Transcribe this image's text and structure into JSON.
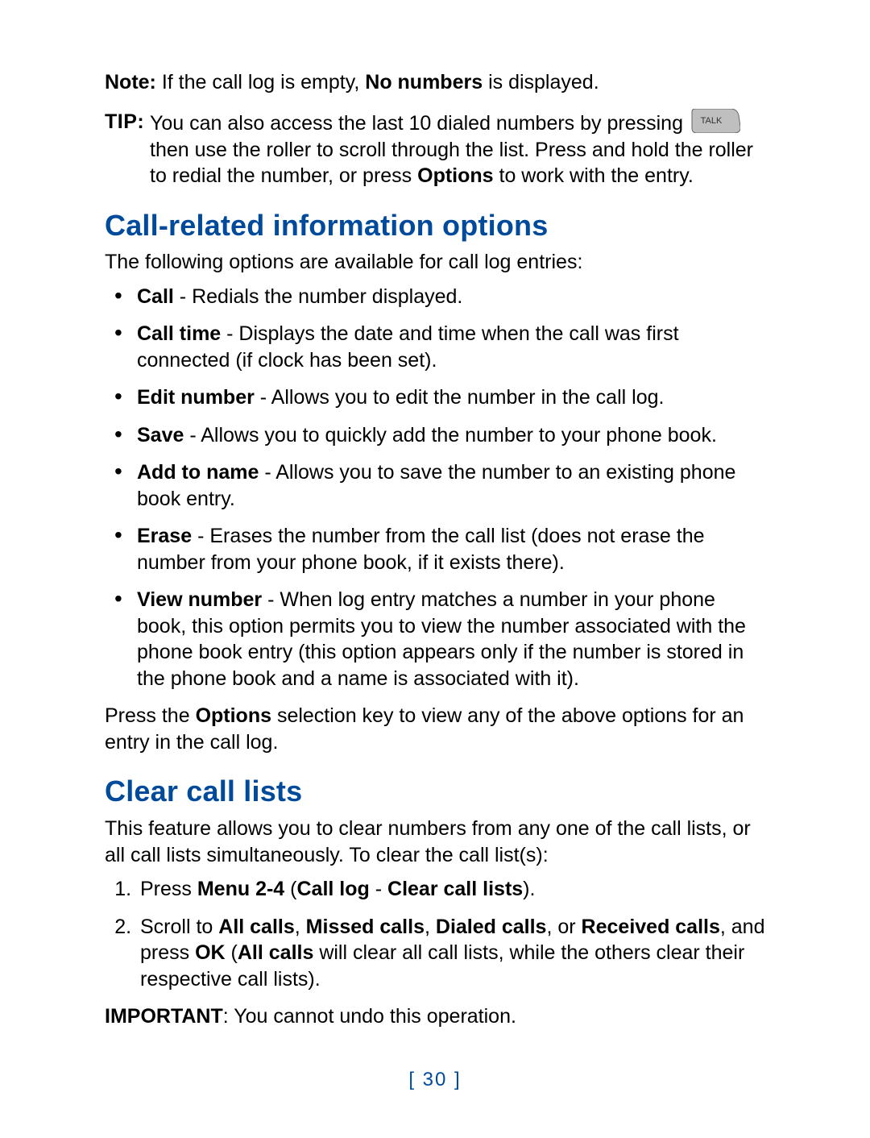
{
  "note": {
    "label": "Note:",
    "pre": "  If the call log is empty, ",
    "bold": "No numbers",
    "post": " is displayed."
  },
  "tip": {
    "label": "TIP:",
    "line1": "You can also access the last 10 dialed numbers by pressing ",
    "rest_pre": "then use the roller to scroll through the list. Press and hold the roller to redial the number, or press ",
    "options_word": "Options",
    "rest_post": " to work with the entry."
  },
  "section1": {
    "heading": "Call-related information options",
    "intro": "The following options are available for call log entries:",
    "bullets": [
      {
        "term": "Call",
        "desc": " - Redials the number displayed."
      },
      {
        "term": "Call time",
        "desc": " - Displays the date and time when the call was first connected (if clock has been set)."
      },
      {
        "term": "Edit number",
        "desc": " - Allows you to edit the number in the call log."
      },
      {
        "term": "Save",
        "desc": " - Allows you to quickly add the number to your phone book."
      },
      {
        "term": "Add to name",
        "desc": " - Allows you to save the number to an existing phone book entry."
      },
      {
        "term": "Erase",
        "desc": " - Erases the number from the call list (does not erase the number from your phone book, if it exists there)."
      },
      {
        "term": "View number",
        "desc": " - When log entry matches a number in your phone book, this option permits you to view the number associated with the phone book entry (this option appears only if the number is stored in the phone book and a name is associated with it)."
      }
    ],
    "outro_pre": "Press the ",
    "outro_bold": "Options",
    "outro_post": " selection key to view any of the above options for an entry in the call log."
  },
  "section2": {
    "heading": "Clear call lists",
    "intro": "This feature allows you to clear numbers from any one of the call lists, or all call lists simultaneously. To clear the call list(s):",
    "step1_pre": "Press ",
    "step1_b1": "Menu 2-4",
    "step1_mid1": " (",
    "step1_b2": "Call log",
    "step1_mid2": " - ",
    "step1_b3": "Clear call lists",
    "step1_post": ").",
    "step2_pre": "Scroll to ",
    "step2_b1": "All calls",
    "step2_c1": ", ",
    "step2_b2": "Missed calls",
    "step2_c2": ", ",
    "step2_b3": "Dialed calls",
    "step2_c3": ", or ",
    "step2_b4": "Received calls",
    "step2_mid": ", and press ",
    "step2_b5": "OK",
    "step2_open": " (",
    "step2_b6": "All calls",
    "step2_post": " will clear all call lists, while the others clear their respective call lists).",
    "important_label": "IMPORTANT",
    "important_text": ": You cannot undo this operation."
  },
  "page_number": "[ 30 ]"
}
